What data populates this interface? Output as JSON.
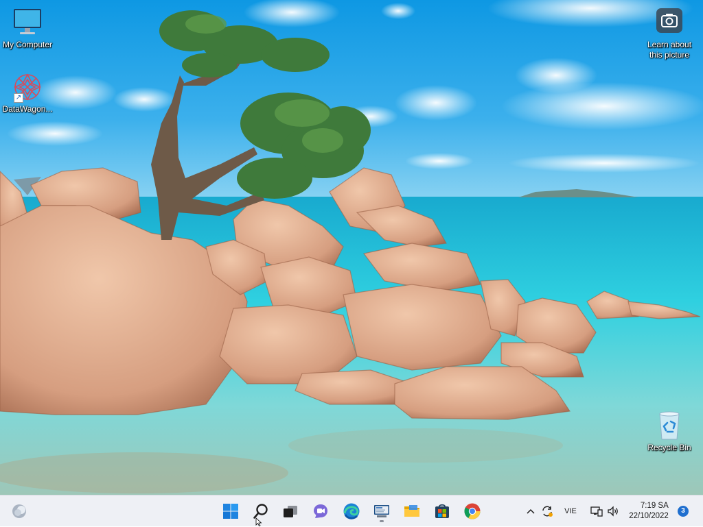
{
  "desktop": {
    "icons": [
      {
        "label": "My Computer"
      },
      {
        "label": "DataWagon..."
      },
      {
        "label": "Learn about this picture",
        "line1": "Learn about",
        "line2": "this picture"
      },
      {
        "label": "Recycle Bin"
      }
    ]
  },
  "taskbar": {
    "apps": [
      "widgets-icon",
      "start-icon",
      "search-icon",
      "task-view-icon",
      "chat-icon",
      "edge-icon",
      "app-icon",
      "file-explorer-icon",
      "store-icon",
      "chrome-icon"
    ],
    "tray": {
      "language": "VIE",
      "time": "7:19 SA",
      "date": "22/10/2022",
      "notifications": "3"
    }
  },
  "colors": {
    "sky": "#2ea6e6",
    "sea": "#31c4d6",
    "rock": "#d9a98b",
    "taskbar": "#eef0f5",
    "accent": "#1f6fcf"
  }
}
